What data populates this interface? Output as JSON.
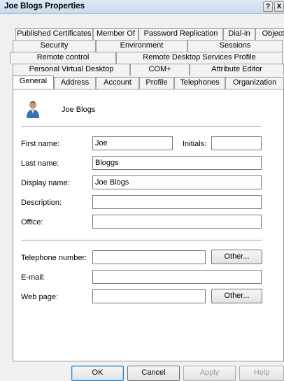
{
  "window": {
    "title": "Joe Blogs Properties",
    "help_button": "?",
    "close_button": "X"
  },
  "tabs": {
    "row1": [
      "Published Certificates",
      "Member Of",
      "Password Replication",
      "Dial-in",
      "Object"
    ],
    "row2": [
      "Security",
      "Environment",
      "Sessions"
    ],
    "row3": [
      "Remote control",
      "Remote Desktop Services Profile"
    ],
    "row4": [
      "Personal Virtual Desktop",
      "COM+",
      "Attribute Editor"
    ],
    "row5": [
      "General",
      "Address",
      "Account",
      "Profile",
      "Telephones",
      "Organization"
    ],
    "active": "General"
  },
  "general": {
    "user_icon": "user-icon",
    "display_name_heading": "Joe Blogs",
    "first_name": {
      "label": "First name:",
      "value": "Joe"
    },
    "initials": {
      "label": "Initials:",
      "value": ""
    },
    "last_name": {
      "label": "Last name:",
      "value": "Bloggs"
    },
    "display_name": {
      "label": "Display name:",
      "value": "Joe Blogs"
    },
    "description": {
      "label": "Description:",
      "value": ""
    },
    "office": {
      "label": "Office:",
      "value": ""
    },
    "telephone": {
      "label": "Telephone number:",
      "value": "",
      "other_label": "Other..."
    },
    "email": {
      "label": "E-mail:",
      "value": ""
    },
    "web_page": {
      "label": "Web page:",
      "value": "",
      "other_label": "Other..."
    }
  },
  "footer": {
    "ok": "OK",
    "cancel": "Cancel",
    "apply": "Apply",
    "help": "Help"
  },
  "colors": {
    "titlebar": "#d4e2f3",
    "panel": "#ffffff",
    "dialog": "#f0f0f0",
    "disabled_text": "#9a9a9a"
  }
}
